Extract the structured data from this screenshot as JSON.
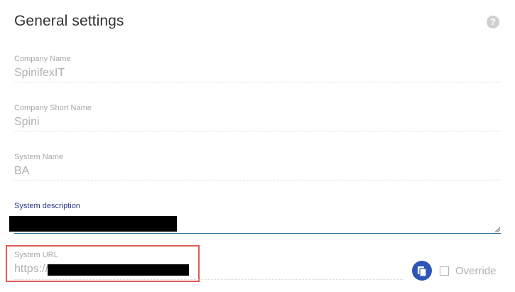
{
  "page": {
    "title": "General settings",
    "help_icon": "question-circle-icon"
  },
  "fields": {
    "company_name": {
      "label": "Company Name",
      "value": "SpinifexIT"
    },
    "company_short_name": {
      "label": "Company Short Name",
      "value": "Spini"
    },
    "system_name": {
      "label": "System Name",
      "value": "BA"
    },
    "system_description": {
      "label": "System description"
    },
    "system_url": {
      "label": "System URL",
      "value": "https://"
    }
  },
  "actions": {
    "copy_icon": "copy-icon",
    "override_label": "Override",
    "override_checked": false
  },
  "colors": {
    "title": "#333333",
    "label": "#a8a8a8",
    "label_active": "#2a3a8a",
    "value": "#b0b0b0",
    "accent": "#2f55b8",
    "highlight": "#e05a55"
  }
}
